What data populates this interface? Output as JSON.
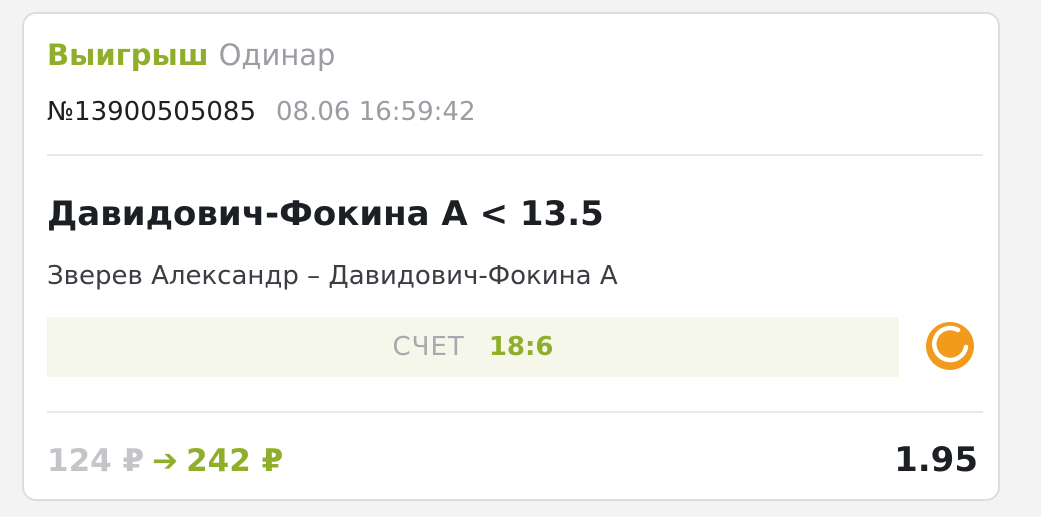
{
  "header": {
    "status": "Выигрыш",
    "bet_type": "Одинар"
  },
  "meta": {
    "bet_number": "№13900505085",
    "datetime": "08.06 16:59:42"
  },
  "selection": {
    "title": "Давидович-Фокина А < 13.5",
    "event": "Зверев Александр – Давидович-Фокина А"
  },
  "score": {
    "label": "СЧЕТ",
    "value": "18:6",
    "sport_icon": "tennis-ball-icon"
  },
  "footer": {
    "stake": "124 ₽",
    "arrow": "➔",
    "payout": "242 ₽",
    "odds": "1.95"
  },
  "colors": {
    "accent_green": "#8faf2a",
    "icon_orange": "#f29a1c",
    "score_bg": "#f5f7ea"
  }
}
